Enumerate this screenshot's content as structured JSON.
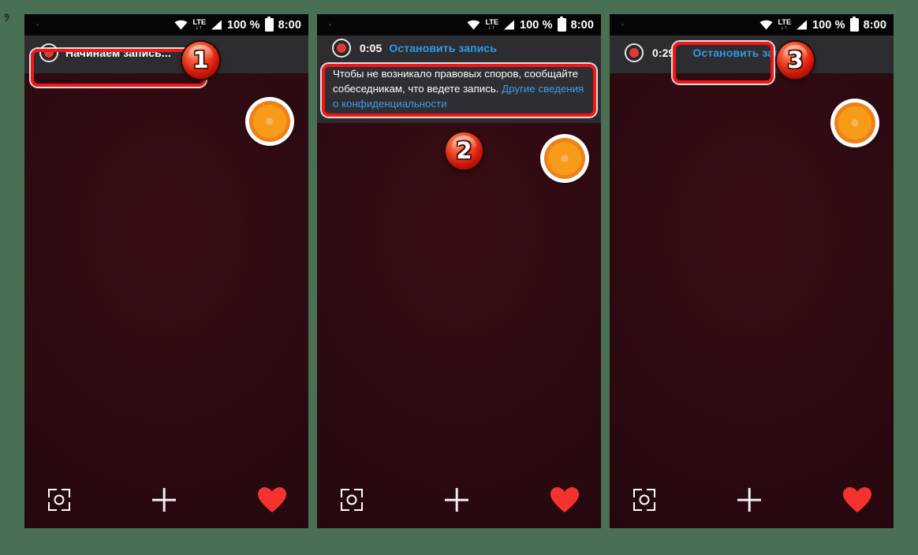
{
  "page": {
    "background_color": "#4a7053",
    "watermark_glyph": "ﻭ"
  },
  "status_bar": {
    "wifi_icon": "wifi-icon",
    "network_label": "LTE",
    "network_arrows": "↓↑",
    "signal_icon": "signal-bars-icon",
    "battery_percent": "100 %",
    "battery_icon": "battery-full-icon",
    "time": "8:00"
  },
  "dock": {
    "camera_icon": "camera-frame-icon",
    "add_icon": "plus-icon",
    "favorite_icon": "heart-icon",
    "heart_color": "#f7322e"
  },
  "sticker": {
    "name": "orange-slice-sticker",
    "ring_color": "#ffffff",
    "peel_color": "#f08019",
    "flesh_color": "#f6b45c",
    "segment_color": "#f79b18"
  },
  "colors": {
    "highlight": "#f41616",
    "link": "#3aa0e8",
    "notification_bg": "#2c2c31",
    "wallpaper": "#2d0a11"
  },
  "panels": [
    {
      "step": "1",
      "notification": {
        "record_icon": "record-dot-icon",
        "title": "Начинаем запись...",
        "timer": "",
        "action": "",
        "body": null
      }
    },
    {
      "step": "2",
      "notification": {
        "record_icon": "record-dot-icon",
        "title": "",
        "timer": "0:05",
        "action": "Остановить запись",
        "body": {
          "text_before": "Чтобы не возникало правовых споров, сообщайте собеседникам, что ведете запись. ",
          "link_text": "Другие сведения о конфиденциальности"
        }
      }
    },
    {
      "step": "3",
      "notification": {
        "record_icon": "record-dot-icon",
        "title": "",
        "timer": "0:29",
        "action": "Остановить запись",
        "body": null
      }
    }
  ]
}
